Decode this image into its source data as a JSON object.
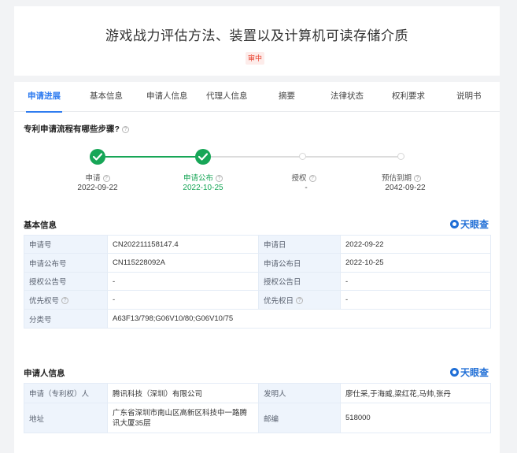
{
  "header": {
    "title": "游戏战力评估方法、装置以及计算机可读存储介质",
    "status": "审中"
  },
  "tabs": [
    {
      "label": "申请进展",
      "active": true
    },
    {
      "label": "基本信息",
      "active": false
    },
    {
      "label": "申请人信息",
      "active": false
    },
    {
      "label": "代理人信息",
      "active": false
    },
    {
      "label": "摘要",
      "active": false
    },
    {
      "label": "法律状态",
      "active": false
    },
    {
      "label": "权利要求",
      "active": false
    },
    {
      "label": "说明书",
      "active": false
    }
  ],
  "progress": {
    "question": "专利申请流程有哪些步骤?",
    "help_icon": "question-circle-icon",
    "steps": [
      {
        "label": "申请",
        "date": "2022-09-22",
        "state": "done"
      },
      {
        "label": "申请公布",
        "date": "2022-10-25",
        "state": "current"
      },
      {
        "label": "授权",
        "date": "-",
        "state": "pending"
      },
      {
        "label": "预估到期",
        "date": "2042-09-22",
        "state": "pending"
      }
    ],
    "colors": {
      "done": "#17a657",
      "pending": "#d6d6d6"
    }
  },
  "basic_info": {
    "title": "基本信息",
    "brand": "天眼查",
    "rows": [
      {
        "k1": "申请号",
        "v1": "CN202211158147.4",
        "k2": "申请日",
        "v2": "2022-09-22"
      },
      {
        "k1": "申请公布号",
        "v1": "CN115228092A",
        "k2": "申请公布日",
        "v2": "2022-10-25"
      },
      {
        "k1": "授权公告号",
        "v1": "-",
        "k2": "授权公告日",
        "v2": "-"
      },
      {
        "k1": "优先权号",
        "v1": "-",
        "k2": "优先权日",
        "v2": "-"
      },
      {
        "k1": "分类号",
        "v1": "A63F13/798;G06V10/80;G06V10/75"
      }
    ]
  },
  "applicant_info": {
    "title": "申请人信息",
    "brand": "天眼查",
    "applicant_label": "申请（专利权）人",
    "applicant_value": "腾讯科技（深圳）有限公司",
    "inventor_label": "发明人",
    "inventor_value": "廖仕采,于海威,梁红花,马帅,张丹",
    "address_label": "地址",
    "address_value": "广东省深圳市南山区高新区科技中一路腾讯大厦35层",
    "postcode_label": "邮编",
    "postcode_value": "518000"
  },
  "theme": {
    "accent": "#2f7cf0",
    "status_red": "#e8412f",
    "table_key_bg": "#eef4fc"
  }
}
